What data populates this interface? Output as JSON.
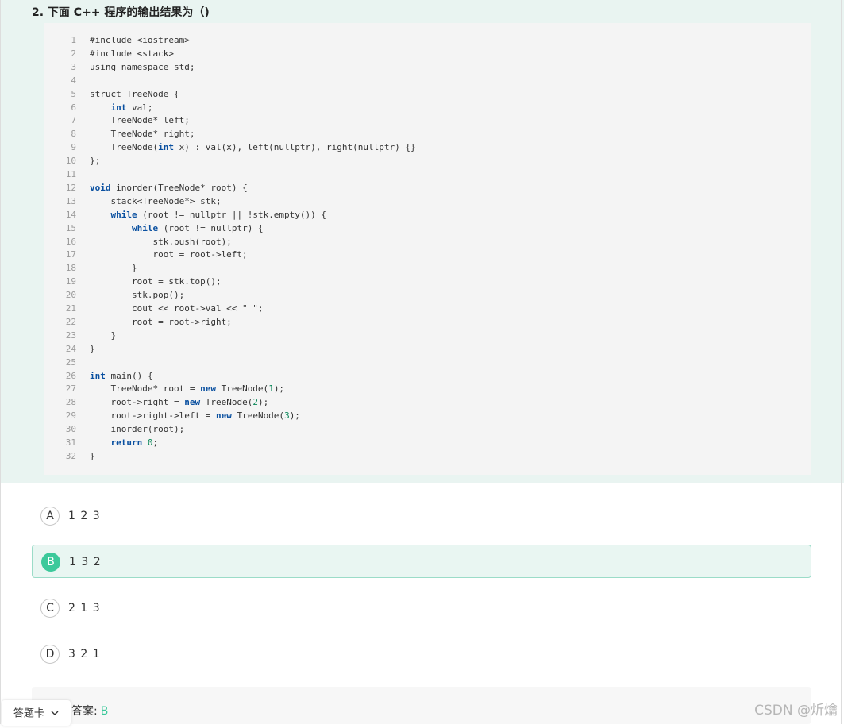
{
  "question": {
    "title": "2. 下面 C++ 程序的输出结果为（)"
  },
  "code": {
    "lines": [
      [
        {
          "t": "#include <iostream>"
        }
      ],
      [
        {
          "t": "#include <stack>"
        }
      ],
      [
        {
          "t": "using namespace std;"
        }
      ],
      [],
      [
        {
          "t": "struct TreeNode {"
        }
      ],
      [
        {
          "t": "    "
        },
        {
          "t": "int",
          "c": "kw"
        },
        {
          "t": " val;"
        }
      ],
      [
        {
          "t": "    TreeNode* left;"
        }
      ],
      [
        {
          "t": "    TreeNode* right;"
        }
      ],
      [
        {
          "t": "    TreeNode("
        },
        {
          "t": "int",
          "c": "kw"
        },
        {
          "t": " x) : val(x), left(nullptr), right(nullptr) {}"
        }
      ],
      [
        {
          "t": "};"
        }
      ],
      [],
      [
        {
          "t": "void",
          "c": "kw"
        },
        {
          "t": " inorder(TreeNode* root) {"
        }
      ],
      [
        {
          "t": "    stack<TreeNode*> stk;"
        }
      ],
      [
        {
          "t": "    "
        },
        {
          "t": "while",
          "c": "kw"
        },
        {
          "t": " (root != nullptr || !stk.empty()) {"
        }
      ],
      [
        {
          "t": "        "
        },
        {
          "t": "while",
          "c": "kw"
        },
        {
          "t": " (root != nullptr) {"
        }
      ],
      [
        {
          "t": "            stk.push(root);"
        }
      ],
      [
        {
          "t": "            root = root->left;"
        }
      ],
      [
        {
          "t": "        }"
        }
      ],
      [
        {
          "t": "        root = stk.top();"
        }
      ],
      [
        {
          "t": "        stk.pop();"
        }
      ],
      [
        {
          "t": "        cout << root->val << \" \";"
        }
      ],
      [
        {
          "t": "        root = root->right;"
        }
      ],
      [
        {
          "t": "    }"
        }
      ],
      [
        {
          "t": "}"
        }
      ],
      [],
      [
        {
          "t": "int",
          "c": "kw"
        },
        {
          "t": " main() {"
        }
      ],
      [
        {
          "t": "    TreeNode* root = "
        },
        {
          "t": "new",
          "c": "kw"
        },
        {
          "t": " TreeNode("
        },
        {
          "t": "1",
          "c": "num"
        },
        {
          "t": ");"
        }
      ],
      [
        {
          "t": "    root->right = "
        },
        {
          "t": "new",
          "c": "kw"
        },
        {
          "t": " TreeNode("
        },
        {
          "t": "2",
          "c": "num"
        },
        {
          "t": ");"
        }
      ],
      [
        {
          "t": "    root->right->left = "
        },
        {
          "t": "new",
          "c": "kw"
        },
        {
          "t": " TreeNode("
        },
        {
          "t": "3",
          "c": "num"
        },
        {
          "t": ");"
        }
      ],
      [
        {
          "t": "    inorder(root);"
        }
      ],
      [
        {
          "t": "    "
        },
        {
          "t": "return",
          "c": "kw"
        },
        {
          "t": " "
        },
        {
          "t": "0",
          "c": "num"
        },
        {
          "t": ";"
        }
      ],
      [
        {
          "t": "}"
        }
      ]
    ]
  },
  "options": [
    {
      "letter": "A",
      "text": "1 2 3",
      "selected": false
    },
    {
      "letter": "B",
      "text": "1 3 2",
      "selected": true
    },
    {
      "letter": "C",
      "text": "2 1 3",
      "selected": false
    },
    {
      "letter": "D",
      "text": "3 2 1",
      "selected": false
    }
  ],
  "answer": {
    "label": "答案:",
    "value": "B"
  },
  "answer_card": {
    "label": "答题卡",
    "icon": "chevron-down-icon"
  },
  "watermark": "CSDN @炘爚",
  "colors": {
    "accent": "#3cc99b",
    "question_bg": "#e9f4f1",
    "code_bg": "#f4f4f4",
    "keyword": "#0a50a0",
    "number": "#098658"
  }
}
